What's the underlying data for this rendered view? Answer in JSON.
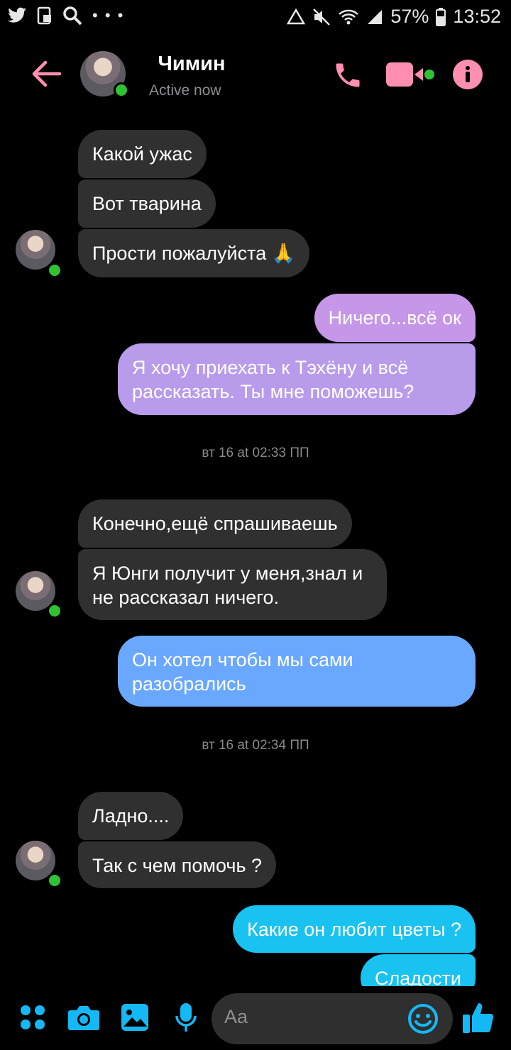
{
  "status_bar": {
    "battery": "57%",
    "time": "13:52",
    "icons": [
      "twitter-icon",
      "screenshot-icon",
      "search-icon",
      "more-icon",
      "recycle-icon",
      "mute-icon",
      "wifi-icon",
      "signal-icon",
      "battery-icon"
    ]
  },
  "header": {
    "contact_name": "Чимин",
    "presence": "Active now",
    "icons": [
      "back-arrow-icon",
      "phone-icon",
      "video-camera-icon",
      "info-icon"
    ]
  },
  "messages": [
    {
      "side": "in",
      "text": "Какой ужас"
    },
    {
      "side": "in",
      "text": "Вот тварина"
    },
    {
      "side": "in",
      "text": "Прости пожалуйста 🙏"
    },
    {
      "side": "out",
      "text": "Ничего...всё ок"
    },
    {
      "side": "out",
      "text": "Я хочу приехать к Тэхёну и всё рассказать. Ты мне поможешь?"
    },
    {
      "side": "time",
      "text": "вт 16 at 02:33 ПП"
    },
    {
      "side": "in",
      "text": "Конечно,ещё спрашиваешь"
    },
    {
      "side": "in",
      "text": "Я Юнги получит у меня,знал и не рассказал ничего."
    },
    {
      "side": "out",
      "text": "Он хотел чтобы мы сами разобрались"
    },
    {
      "side": "time",
      "text": "вт 16 at 02:34 ПП"
    },
    {
      "side": "in",
      "text": "Ладно...."
    },
    {
      "side": "in",
      "text": "Так с чем помочь ?"
    },
    {
      "side": "out",
      "text": "Какие он любит цветы ?"
    },
    {
      "side": "out",
      "text": "Сладости"
    }
  ],
  "composer": {
    "placeholder": "Aa",
    "icons": [
      "apps-icon",
      "camera-icon",
      "gallery-icon",
      "microphone-icon",
      "emoji-icon",
      "thumbs-up-icon"
    ]
  },
  "colors": {
    "accent_pink": "#ff8fb0",
    "online_green": "#31c233",
    "bubble_in": "#303030",
    "bubble_out_purple": "#c697e8",
    "bubble_out_blue": "#6aa8ff",
    "bubble_out_cyan": "#19c2f0",
    "composer_icons": "#14b8f5"
  }
}
